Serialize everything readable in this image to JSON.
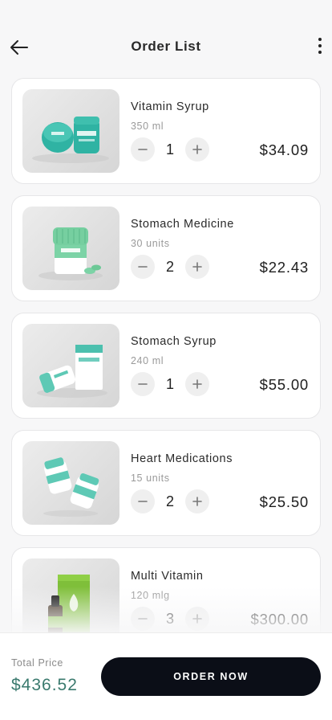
{
  "header": {
    "title": "Order List"
  },
  "items": [
    {
      "name": "Vitamin Syrup",
      "size": "350 ml",
      "quantity": "1",
      "price": "$34.09",
      "image": "vitamin-syrup-jars"
    },
    {
      "name": "Stomach Medicine",
      "size": "30 units",
      "quantity": "2",
      "price": "$22.43",
      "image": "pills-jar"
    },
    {
      "name": "Stomach Syrup",
      "size": "240 ml",
      "quantity": "1",
      "price": "$55.00",
      "image": "syrup-bottle-box"
    },
    {
      "name": "Heart Medications",
      "size": "15 units",
      "quantity": "2",
      "price": "$25.50",
      "image": "floating-pill-bottles"
    },
    {
      "name": "Multi Vitamin",
      "size": "120 mlg",
      "quantity": "3",
      "price": "$300.00",
      "image": "dropper-bottle-box"
    }
  ],
  "footer": {
    "total_label": "Total Price",
    "total_value": "$436.52",
    "order_label": "ORDER NOW"
  },
  "colors": {
    "accent": "#5bc0a8",
    "total": "#3a7a6e",
    "button": "#0b0e17"
  }
}
